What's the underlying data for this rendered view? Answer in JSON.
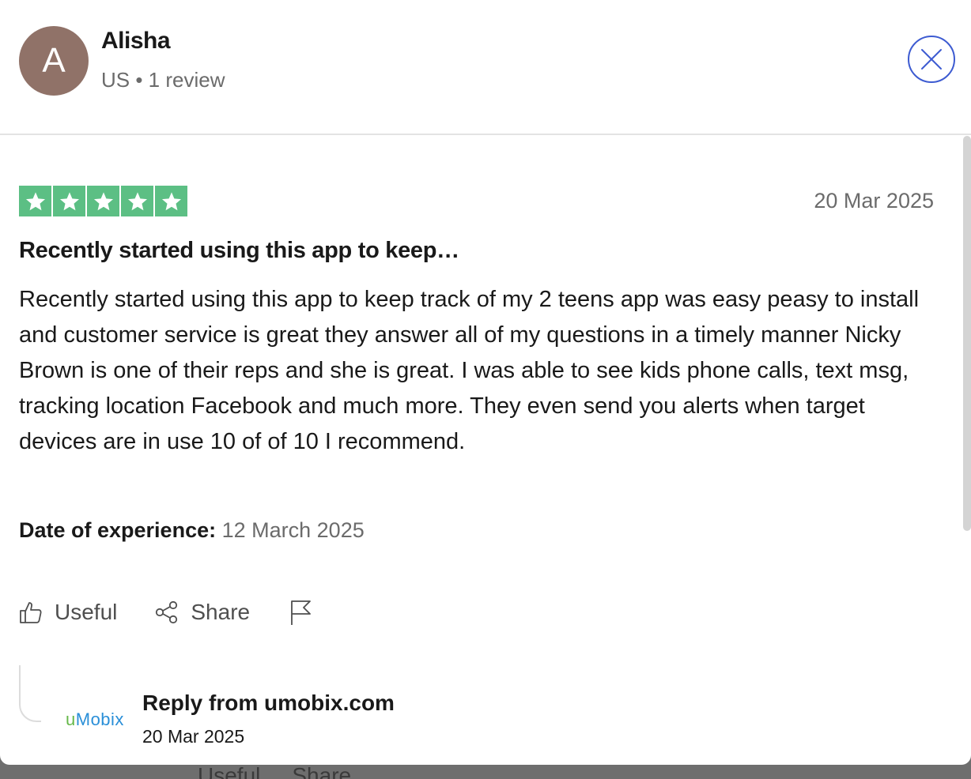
{
  "reviewer": {
    "initial": "A",
    "name": "Alisha",
    "meta": "US • 1 review",
    "avatar_color": "#907268"
  },
  "rating": {
    "stars": 5,
    "max": 5,
    "color": "#5cbf84"
  },
  "review": {
    "date": "20 Mar 2025",
    "title": "Recently started using this app to keep…",
    "body": "Recently started using this app to keep track of my 2 teens app was easy peasy to install and customer service is great they answer all of my questions in a timely manner Nicky Brown is one of their reps and she is great. I was able to see kids phone calls, text msg, tracking location Facebook and much more. They even send you alerts when target devices are in use 10 of of 10 I recommend.",
    "experience_label": "Date of experience:",
    "experience_value": "12 March 2025"
  },
  "actions": {
    "useful_label": "Useful",
    "share_label": "Share"
  },
  "reply": {
    "logo_u": "u",
    "logo_rest": "Mobix",
    "from": "Reply from umobix.com",
    "date": "20 Mar 2025"
  },
  "underlay": {
    "useful_label": "Useful",
    "share_label": "Share"
  },
  "icons": [
    "close-icon",
    "star-icon",
    "thumbs-up-icon",
    "share-icon",
    "flag-icon"
  ],
  "accent_color": "#3d5bd1"
}
